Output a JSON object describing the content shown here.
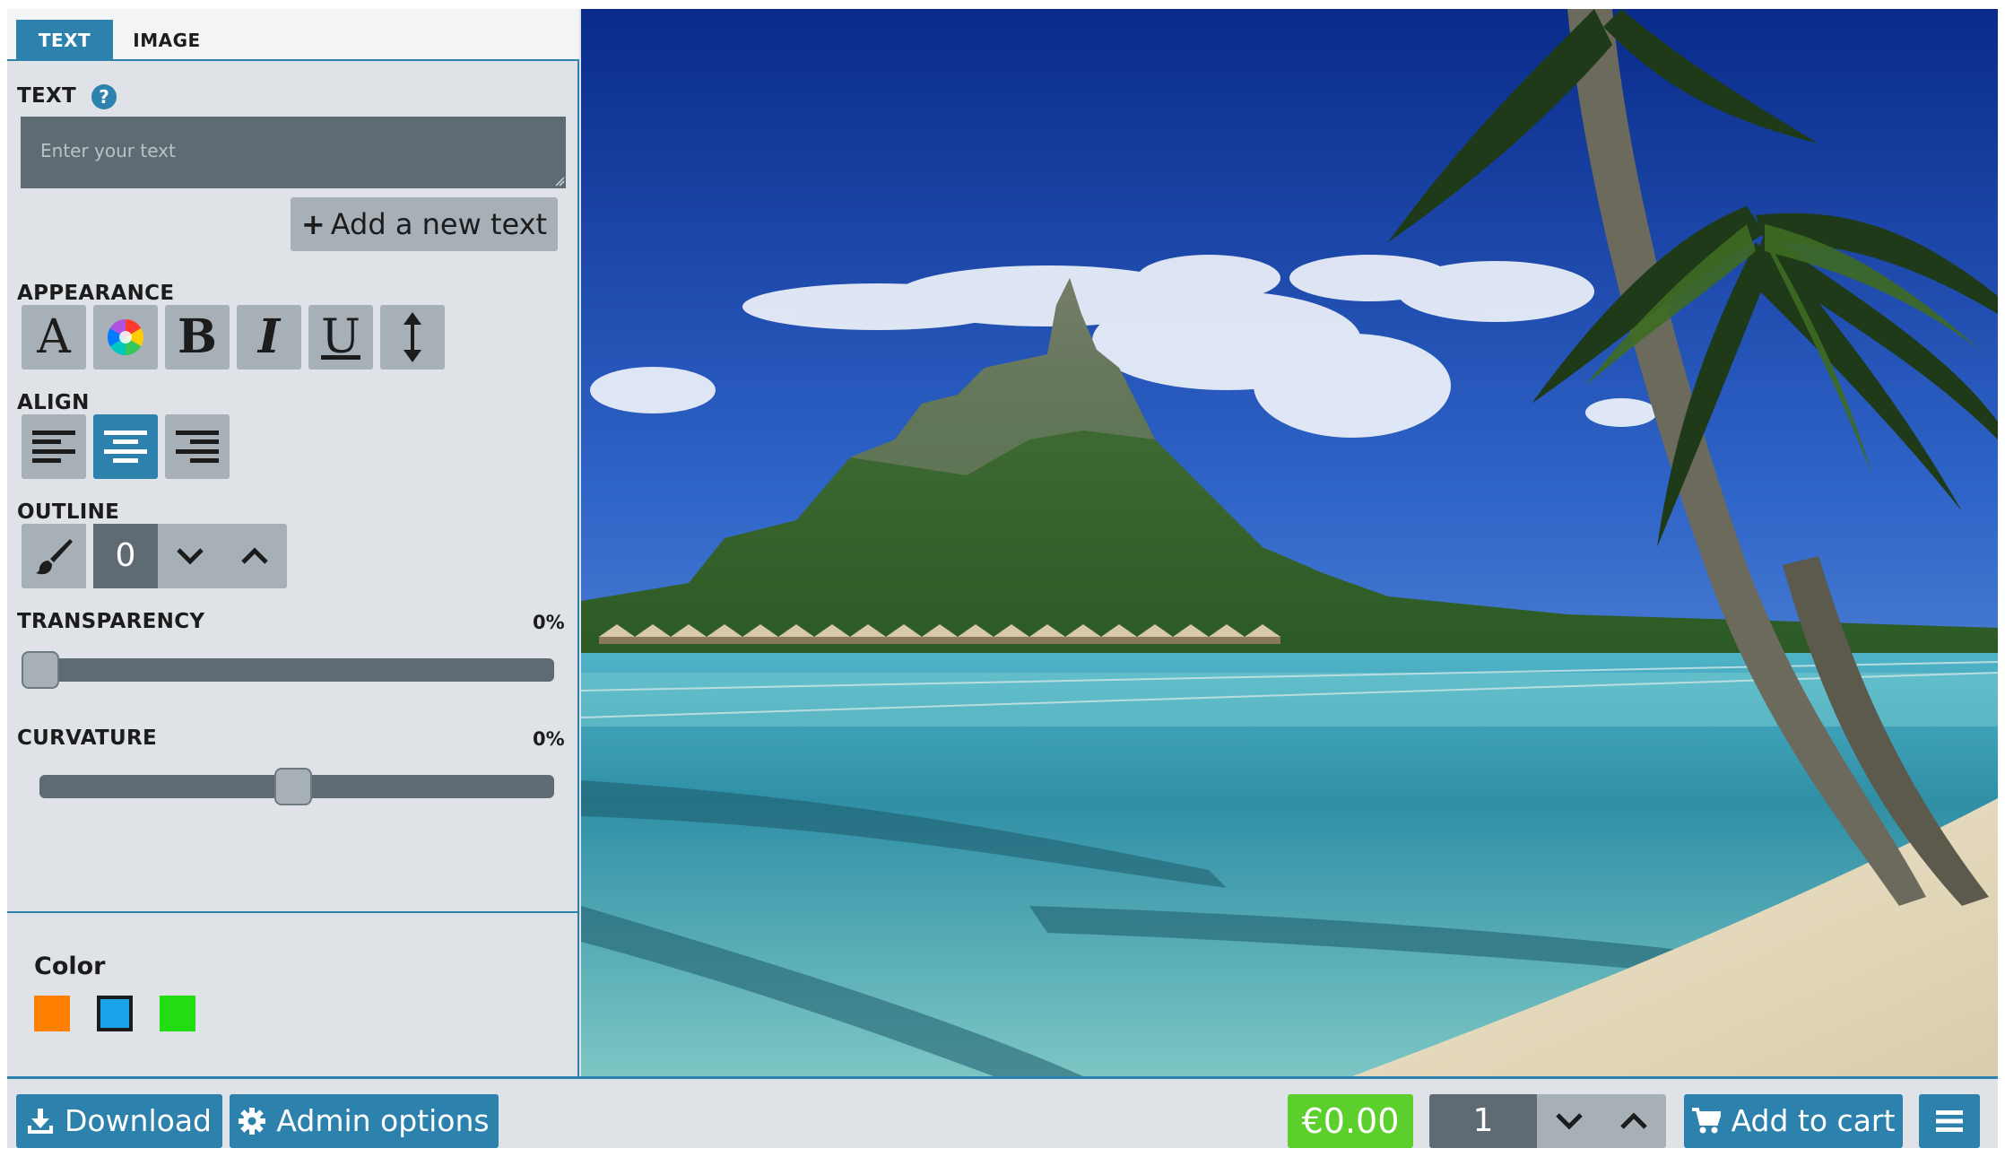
{
  "tabs": {
    "text": "TEXT",
    "image": "IMAGE"
  },
  "text_section": {
    "label": "TEXT",
    "help_glyph": "?",
    "placeholder": "Enter your text",
    "add_button": "Add a new text",
    "add_button_icon": "+"
  },
  "appearance": {
    "label": "APPEARANCE",
    "font_glyph": "A",
    "bold_glyph": "B",
    "italic_glyph": "I",
    "underline_glyph": "U"
  },
  "align": {
    "label": "ALIGN",
    "active": "center"
  },
  "outline": {
    "label": "OUTLINE",
    "value": "0"
  },
  "transparency": {
    "label": "TRANSPARENCY",
    "value": "0%",
    "level": 0
  },
  "curvature": {
    "label": "CURVATURE",
    "value": "0%",
    "level": 0.5
  },
  "color_panel": {
    "title": "Color",
    "swatches": [
      "#ff7f00",
      "#1aa3e8",
      "#22dd11"
    ],
    "selected_index": 1
  },
  "bottom": {
    "download": "Download",
    "admin": "Admin options",
    "price": "€0.00",
    "quantity": "1",
    "add_to_cart": "Add to cart"
  },
  "colors": {
    "accent": "#2d82ad",
    "price_green": "#5ccf2c",
    "panel_bg": "#dfe3e8",
    "dark_control": "#5e6b72",
    "light_control": "#a7b0b6"
  },
  "icons": {
    "help": "question-circle-icon",
    "download": "download-icon",
    "admin": "gear-icon",
    "cart": "cart-icon",
    "menu": "hamburger-menu-icon"
  }
}
